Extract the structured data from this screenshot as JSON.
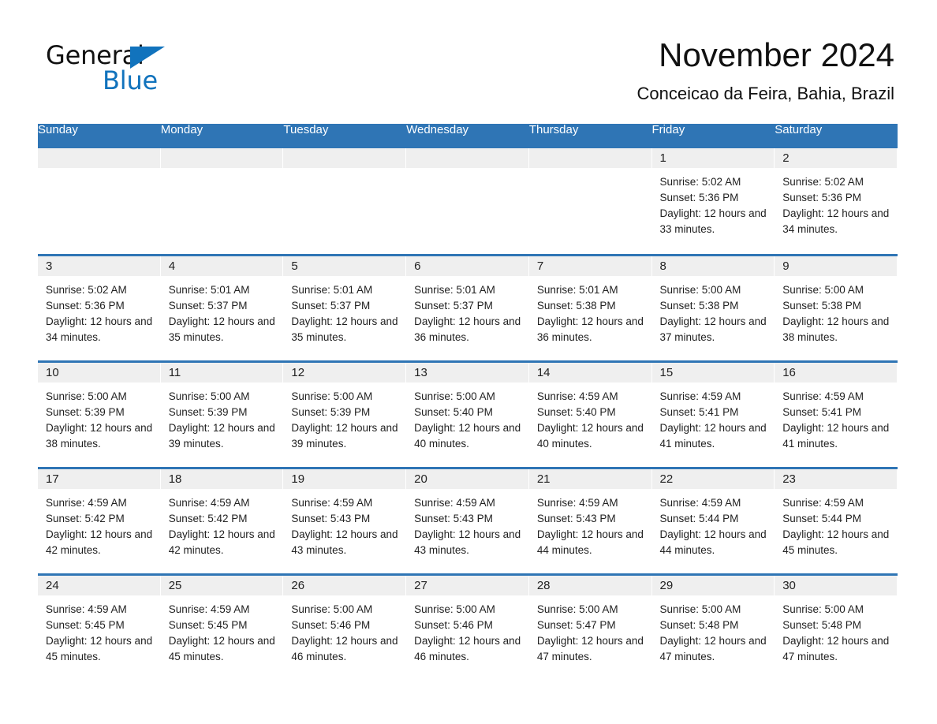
{
  "brand": {
    "line1": "General",
    "line2": "Blue",
    "triangle_color": "#1173bd"
  },
  "header": {
    "month_title": "November 2024",
    "location": "Conceicao da Feira, Bahia, Brazil"
  },
  "theme": {
    "accent_blue": "#2f75b5",
    "date_band_gray": "#efefef",
    "text_dark": "#1f1f1f",
    "header_text": "#ffffff"
  },
  "weekdays": [
    "Sunday",
    "Monday",
    "Tuesday",
    "Wednesday",
    "Thursday",
    "Friday",
    "Saturday"
  ],
  "weeks": [
    [
      {
        "date": "",
        "empty": true
      },
      {
        "date": "",
        "empty": true
      },
      {
        "date": "",
        "empty": true
      },
      {
        "date": "",
        "empty": true
      },
      {
        "date": "",
        "empty": true
      },
      {
        "date": "1",
        "sunrise": "Sunrise: 5:02 AM",
        "sunset": "Sunset: 5:36 PM",
        "daylight": "Daylight: 12 hours and 33 minutes."
      },
      {
        "date": "2",
        "sunrise": "Sunrise: 5:02 AM",
        "sunset": "Sunset: 5:36 PM",
        "daylight": "Daylight: 12 hours and 34 minutes."
      }
    ],
    [
      {
        "date": "3",
        "sunrise": "Sunrise: 5:02 AM",
        "sunset": "Sunset: 5:36 PM",
        "daylight": "Daylight: 12 hours and 34 minutes."
      },
      {
        "date": "4",
        "sunrise": "Sunrise: 5:01 AM",
        "sunset": "Sunset: 5:37 PM",
        "daylight": "Daylight: 12 hours and 35 minutes."
      },
      {
        "date": "5",
        "sunrise": "Sunrise: 5:01 AM",
        "sunset": "Sunset: 5:37 PM",
        "daylight": "Daylight: 12 hours and 35 minutes."
      },
      {
        "date": "6",
        "sunrise": "Sunrise: 5:01 AM",
        "sunset": "Sunset: 5:37 PM",
        "daylight": "Daylight: 12 hours and 36 minutes."
      },
      {
        "date": "7",
        "sunrise": "Sunrise: 5:01 AM",
        "sunset": "Sunset: 5:38 PM",
        "daylight": "Daylight: 12 hours and 36 minutes."
      },
      {
        "date": "8",
        "sunrise": "Sunrise: 5:00 AM",
        "sunset": "Sunset: 5:38 PM",
        "daylight": "Daylight: 12 hours and 37 minutes."
      },
      {
        "date": "9",
        "sunrise": "Sunrise: 5:00 AM",
        "sunset": "Sunset: 5:38 PM",
        "daylight": "Daylight: 12 hours and 38 minutes."
      }
    ],
    [
      {
        "date": "10",
        "sunrise": "Sunrise: 5:00 AM",
        "sunset": "Sunset: 5:39 PM",
        "daylight": "Daylight: 12 hours and 38 minutes."
      },
      {
        "date": "11",
        "sunrise": "Sunrise: 5:00 AM",
        "sunset": "Sunset: 5:39 PM",
        "daylight": "Daylight: 12 hours and 39 minutes."
      },
      {
        "date": "12",
        "sunrise": "Sunrise: 5:00 AM",
        "sunset": "Sunset: 5:39 PM",
        "daylight": "Daylight: 12 hours and 39 minutes."
      },
      {
        "date": "13",
        "sunrise": "Sunrise: 5:00 AM",
        "sunset": "Sunset: 5:40 PM",
        "daylight": "Daylight: 12 hours and 40 minutes."
      },
      {
        "date": "14",
        "sunrise": "Sunrise: 4:59 AM",
        "sunset": "Sunset: 5:40 PM",
        "daylight": "Daylight: 12 hours and 40 minutes."
      },
      {
        "date": "15",
        "sunrise": "Sunrise: 4:59 AM",
        "sunset": "Sunset: 5:41 PM",
        "daylight": "Daylight: 12 hours and 41 minutes."
      },
      {
        "date": "16",
        "sunrise": "Sunrise: 4:59 AM",
        "sunset": "Sunset: 5:41 PM",
        "daylight": "Daylight: 12 hours and 41 minutes."
      }
    ],
    [
      {
        "date": "17",
        "sunrise": "Sunrise: 4:59 AM",
        "sunset": "Sunset: 5:42 PM",
        "daylight": "Daylight: 12 hours and 42 minutes."
      },
      {
        "date": "18",
        "sunrise": "Sunrise: 4:59 AM",
        "sunset": "Sunset: 5:42 PM",
        "daylight": "Daylight: 12 hours and 42 minutes."
      },
      {
        "date": "19",
        "sunrise": "Sunrise: 4:59 AM",
        "sunset": "Sunset: 5:43 PM",
        "daylight": "Daylight: 12 hours and 43 minutes."
      },
      {
        "date": "20",
        "sunrise": "Sunrise: 4:59 AM",
        "sunset": "Sunset: 5:43 PM",
        "daylight": "Daylight: 12 hours and 43 minutes."
      },
      {
        "date": "21",
        "sunrise": "Sunrise: 4:59 AM",
        "sunset": "Sunset: 5:43 PM",
        "daylight": "Daylight: 12 hours and 44 minutes."
      },
      {
        "date": "22",
        "sunrise": "Sunrise: 4:59 AM",
        "sunset": "Sunset: 5:44 PM",
        "daylight": "Daylight: 12 hours and 44 minutes."
      },
      {
        "date": "23",
        "sunrise": "Sunrise: 4:59 AM",
        "sunset": "Sunset: 5:44 PM",
        "daylight": "Daylight: 12 hours and 45 minutes."
      }
    ],
    [
      {
        "date": "24",
        "sunrise": "Sunrise: 4:59 AM",
        "sunset": "Sunset: 5:45 PM",
        "daylight": "Daylight: 12 hours and 45 minutes."
      },
      {
        "date": "25",
        "sunrise": "Sunrise: 4:59 AM",
        "sunset": "Sunset: 5:45 PM",
        "daylight": "Daylight: 12 hours and 45 minutes."
      },
      {
        "date": "26",
        "sunrise": "Sunrise: 5:00 AM",
        "sunset": "Sunset: 5:46 PM",
        "daylight": "Daylight: 12 hours and 46 minutes."
      },
      {
        "date": "27",
        "sunrise": "Sunrise: 5:00 AM",
        "sunset": "Sunset: 5:46 PM",
        "daylight": "Daylight: 12 hours and 46 minutes."
      },
      {
        "date": "28",
        "sunrise": "Sunrise: 5:00 AM",
        "sunset": "Sunset: 5:47 PM",
        "daylight": "Daylight: 12 hours and 47 minutes."
      },
      {
        "date": "29",
        "sunrise": "Sunrise: 5:00 AM",
        "sunset": "Sunset: 5:48 PM",
        "daylight": "Daylight: 12 hours and 47 minutes."
      },
      {
        "date": "30",
        "sunrise": "Sunrise: 5:00 AM",
        "sunset": "Sunset: 5:48 PM",
        "daylight": "Daylight: 12 hours and 47 minutes."
      }
    ]
  ]
}
